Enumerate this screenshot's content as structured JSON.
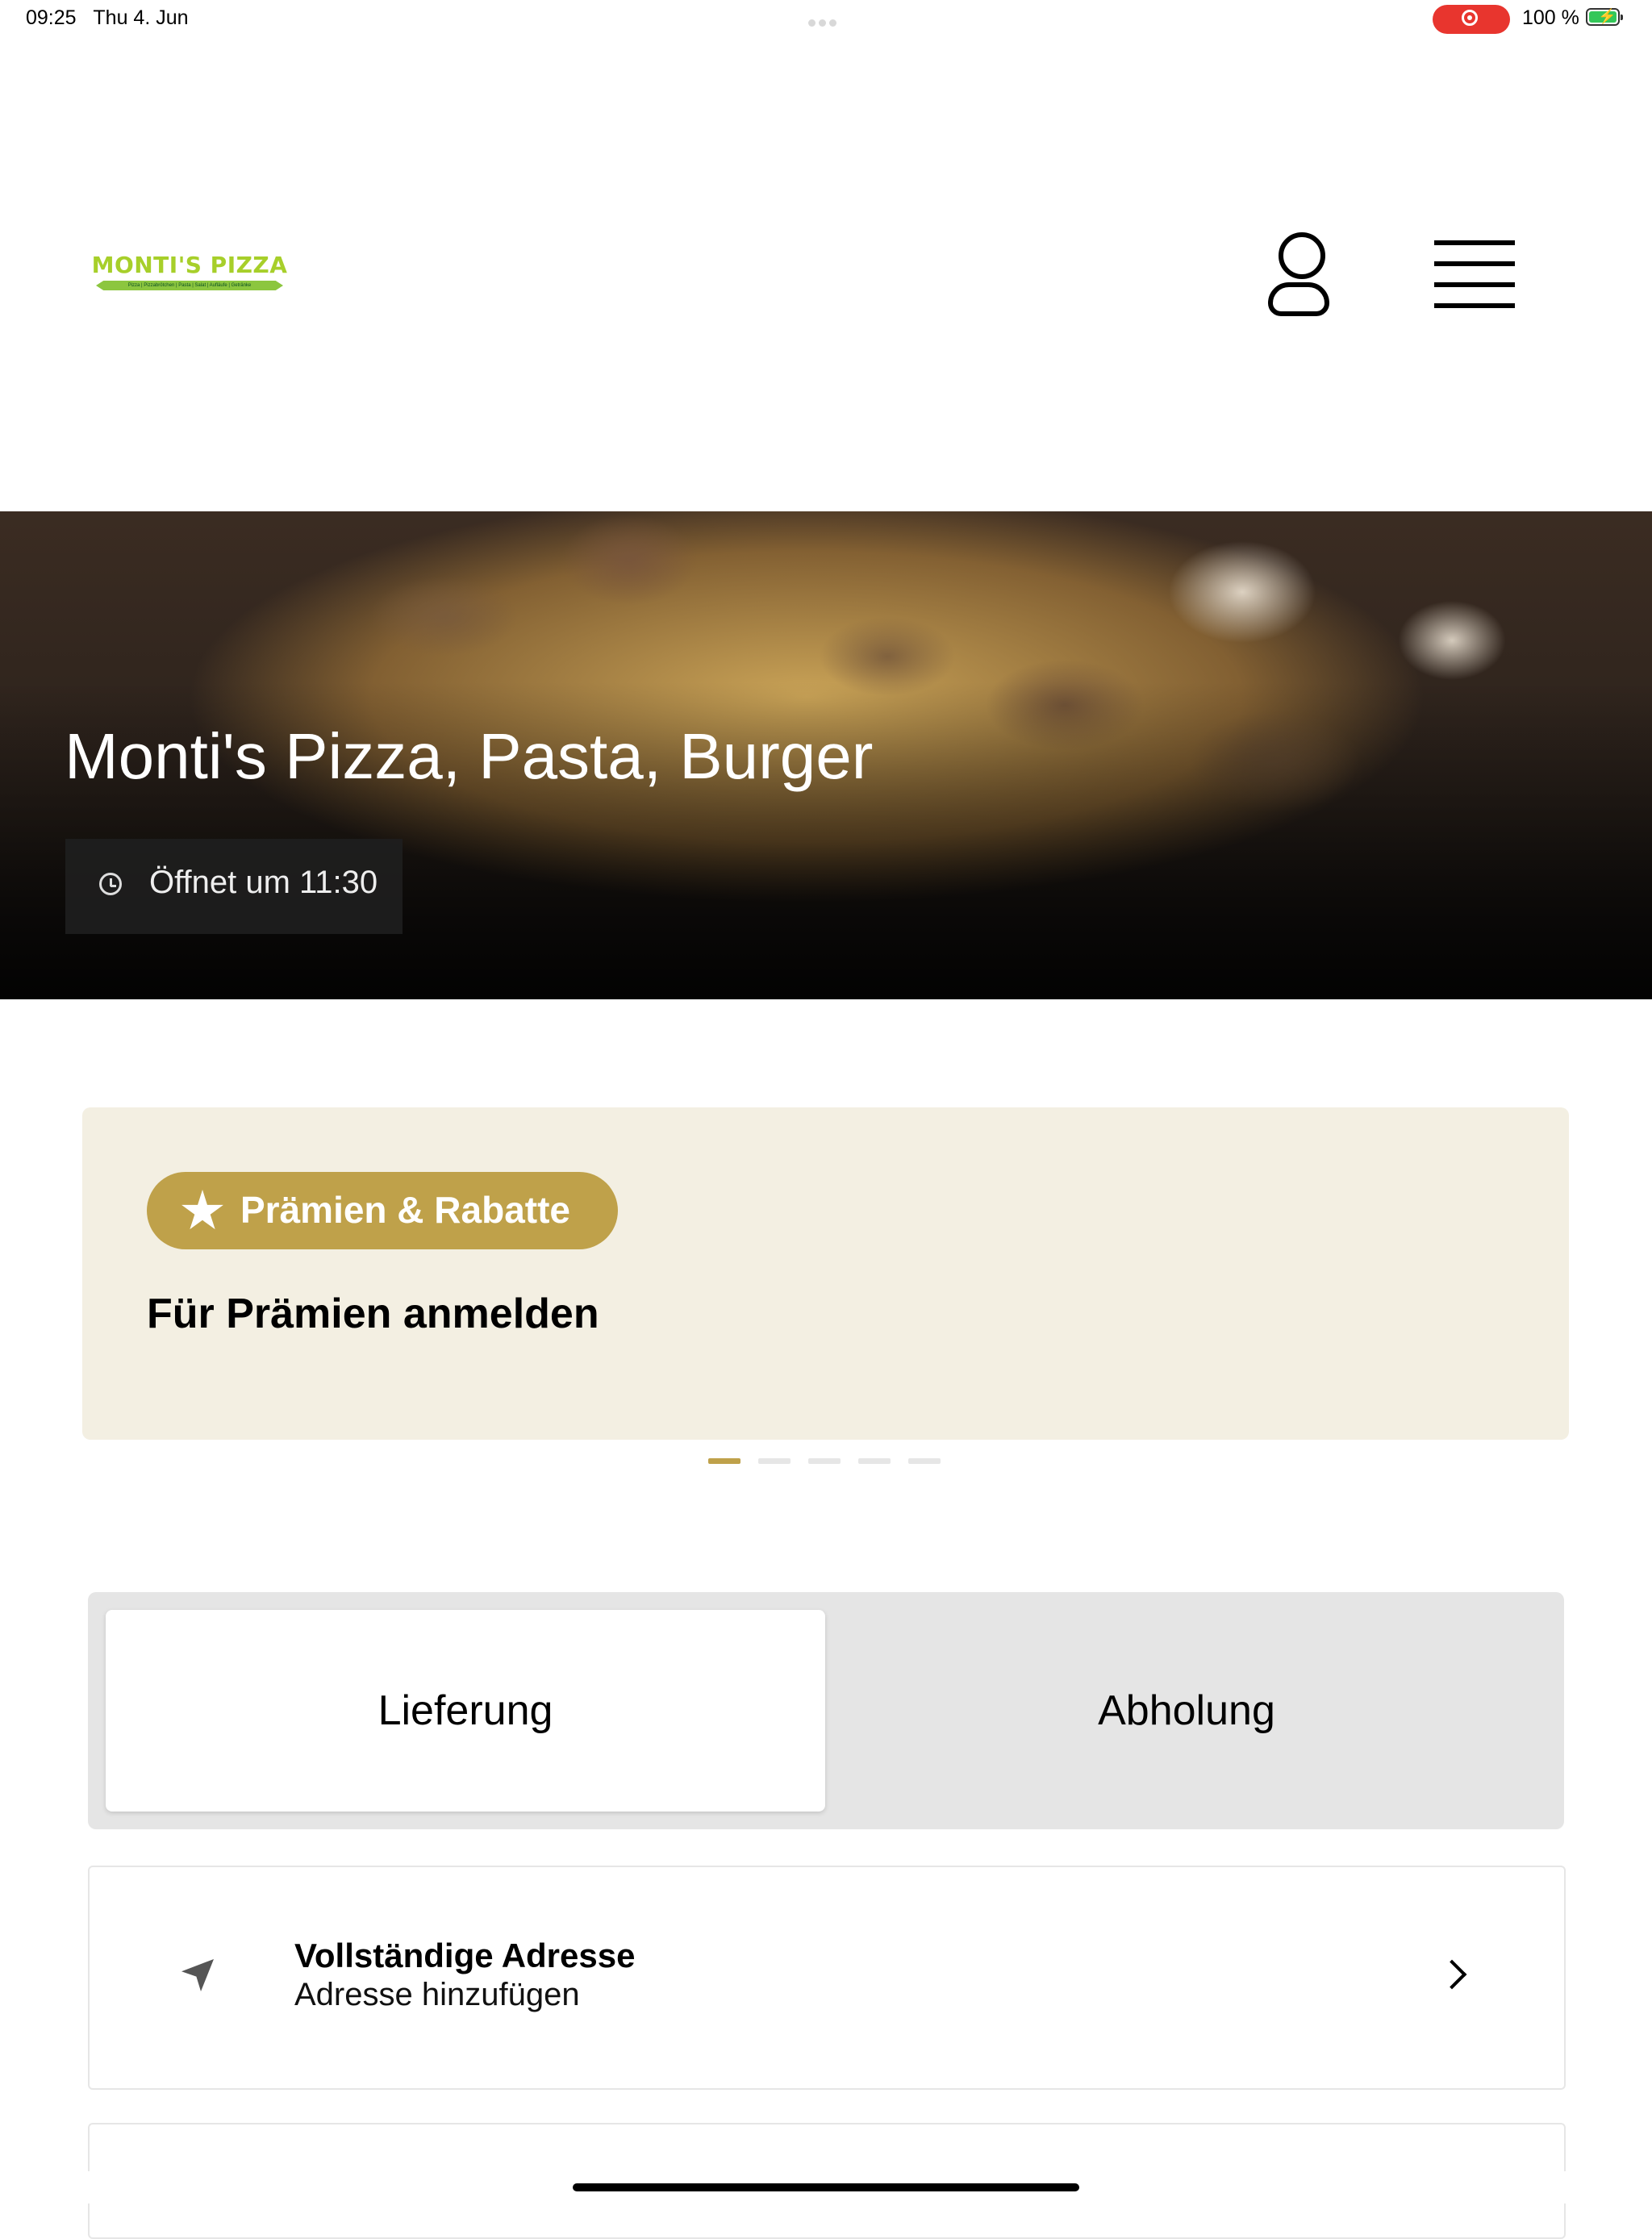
{
  "status_bar": {
    "time": "09:25",
    "date": "Thu 4. Jun",
    "battery_text": "100 %"
  },
  "header": {
    "logo_text": "MONTI'S PIZZA",
    "logo_tagline": "Pizza | Pizzabrötchen | Pasta | Salat | Aufläufe | Getränke",
    "profile_icon": "person-icon",
    "menu_icon": "hamburger-menu-icon"
  },
  "hero": {
    "title": "Monti's Pizza, Pasta, Burger",
    "opening_status": "Öffnet um 11:30",
    "opening_icon": "clock-icon"
  },
  "rewards": {
    "badge_label": "Prämien & Rabatte",
    "badge_icon": "star-icon",
    "title": "Für Prämien anmelden",
    "pager_count": 5,
    "pager_active_index": 0
  },
  "order_mode": {
    "options": [
      "Lieferung",
      "Abholung"
    ],
    "selected": "Lieferung"
  },
  "address": {
    "title": "Vollständige Adresse",
    "subtitle": "Adresse hinzufügen",
    "icon": "location-arrow-icon",
    "trailing_icon": "chevron-right-icon"
  },
  "colors": {
    "accent_gold": "#bfa14a",
    "rewards_background": "#f3efe2",
    "logo_green": "#a7cf2a",
    "recording_red": "#e8352e"
  }
}
